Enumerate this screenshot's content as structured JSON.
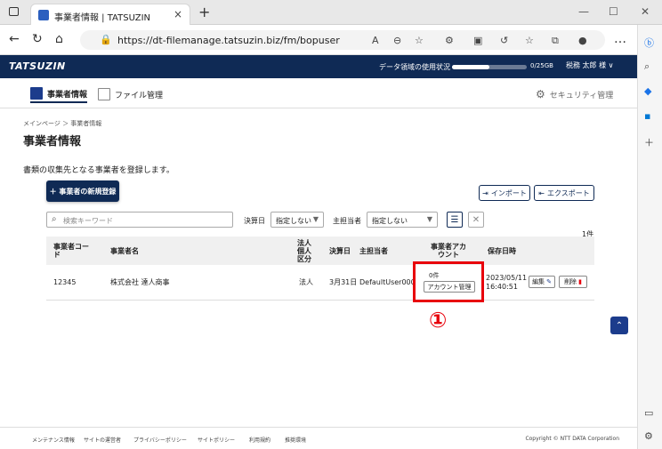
{
  "browser": {
    "tab_title": "事業者情報 | TATSUZIN",
    "tab_close": "×",
    "new_tab": "+",
    "url": "https://dt-filemanage.tatsuzin.biz/fm/bopuser",
    "window_controls": [
      "—",
      "☐",
      "✕"
    ]
  },
  "header": {
    "logo": "TATSUZIN",
    "usage_label": "データ領域の使用状況",
    "usage_text": "0/25GB",
    "usage_fraction": 0.02,
    "user": "税務 太郎 様 ∨"
  },
  "nav": {
    "items": [
      {
        "label": "事業者情報",
        "active": true
      },
      {
        "label": "ファイル管理",
        "active": false
      }
    ],
    "security": "セキュリティ管理"
  },
  "page": {
    "breadcrumb": "メインページ ＞ 事業者情報",
    "title": "事業者情報",
    "description": "書類の収集先となる事業者を登録します。"
  },
  "toolbar": {
    "new_button": "＋ 事業者の新規登録",
    "import_button": "インポート",
    "export_button": "エクスポート"
  },
  "filters": {
    "search_placeholder": "検索キーワード",
    "fiscal_label": "決算日",
    "fiscal_value": "指定しない",
    "owner_label": "主担当者",
    "owner_value": "指定しない",
    "count": "1件"
  },
  "table": {
    "headers": [
      "事業者コード",
      "事業者名",
      "法人個人区分",
      "決算日",
      "主担当者",
      "事業者アカウント",
      "保存日時"
    ],
    "rows": [
      {
        "code": "12345",
        "name": "株式会社 達人商事",
        "type": "法人",
        "fiscal": "3月31日",
        "owner": "DefaultUser000",
        "account_count": "0件",
        "account_button": "アカウント管理",
        "saved": "2023/05/11 16:40:51",
        "edit": "編集",
        "delete": "削除"
      }
    ]
  },
  "annotation": {
    "marker": "①",
    "color": "#e8000b"
  },
  "footer": {
    "links": [
      "メンテナンス情報",
      "サイトの運営者",
      "プライバシーポリシー",
      "サイトポリシー",
      "利用規約",
      "推奨環境"
    ],
    "copyright": "Copyright © NTT DATA Corporation"
  }
}
